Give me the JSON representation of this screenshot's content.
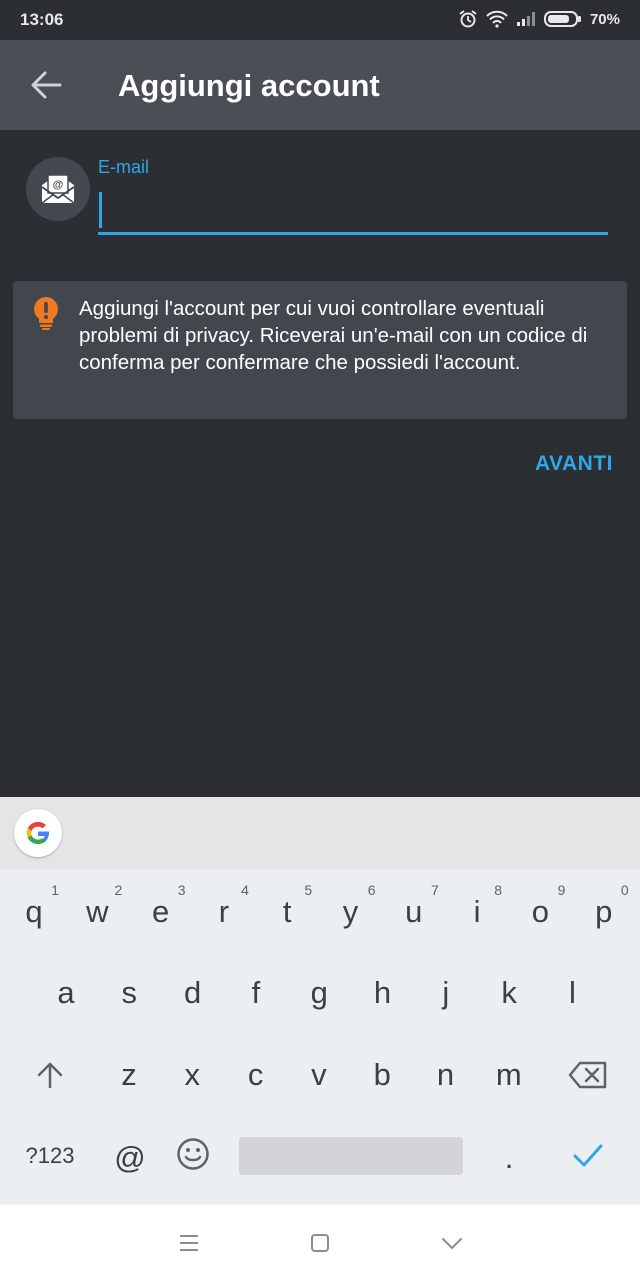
{
  "status_bar": {
    "time": "13:06",
    "battery": "70%"
  },
  "app_bar": {
    "title": "Aggiungi account"
  },
  "form": {
    "email_label": "E-mail",
    "email_value": ""
  },
  "info": {
    "text": "Aggiungi l'account per cui vuoi controllare eventuali problemi di privacy. Riceverai un'e-mail con un codice di conferma per confermare che possiedi l'account."
  },
  "actions": {
    "next_label": "AVANTI"
  },
  "colors": {
    "accent": "#2ea6e8",
    "warning": "#f07a1d",
    "app_bar": "#4a4f56",
    "background": "#2b2e33"
  },
  "keyboard": {
    "row1": [
      {
        "key": "q",
        "hint": "1"
      },
      {
        "key": "w",
        "hint": "2"
      },
      {
        "key": "e",
        "hint": "3"
      },
      {
        "key": "r",
        "hint": "4"
      },
      {
        "key": "t",
        "hint": "5"
      },
      {
        "key": "y",
        "hint": "6"
      },
      {
        "key": "u",
        "hint": "7"
      },
      {
        "key": "i",
        "hint": "8"
      },
      {
        "key": "o",
        "hint": "9"
      },
      {
        "key": "p",
        "hint": "0"
      }
    ],
    "row2": [
      "a",
      "s",
      "d",
      "f",
      "g",
      "h",
      "j",
      "k",
      "l"
    ],
    "row3": [
      "z",
      "x",
      "c",
      "v",
      "b",
      "n",
      "m"
    ],
    "symbols_label": "?123",
    "at_label": "@",
    "period_label": "."
  }
}
